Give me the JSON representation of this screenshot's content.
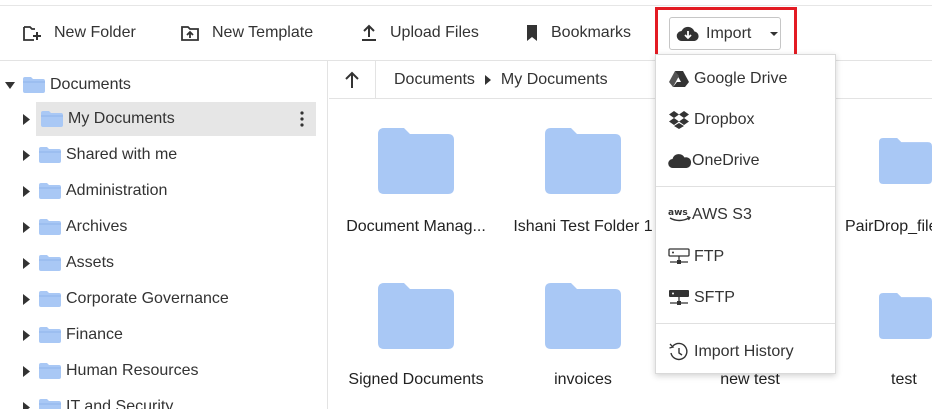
{
  "toolbar": {
    "new_folder": "New Folder",
    "new_template": "New Template",
    "upload_files": "Upload Files",
    "bookmarks": "Bookmarks",
    "import": "Import"
  },
  "tree": {
    "root": "Documents",
    "items": [
      "My Documents",
      "Shared with me",
      "Administration",
      "Archives",
      "Assets",
      "Corporate Governance",
      "Finance",
      "Human Resources",
      "IT and Security"
    ]
  },
  "breadcrumb": [
    "Documents",
    "My Documents"
  ],
  "grid": {
    "row1": [
      "Document Manag...",
      "Ishani Test Folder 1",
      "",
      "PairDrop_file"
    ],
    "row2": [
      "Signed Documents",
      "invoices",
      "new test",
      "test"
    ]
  },
  "import_menu": {
    "cloud": [
      "Google Drive",
      "Dropbox",
      "OneDrive"
    ],
    "servers": [
      "AWS S3",
      "FTP",
      "SFTP"
    ],
    "history": "Import History"
  },
  "colors": {
    "folder": "#a9c8f5",
    "highlight": "#e31b23",
    "selected_row": "#e6e6e6"
  }
}
